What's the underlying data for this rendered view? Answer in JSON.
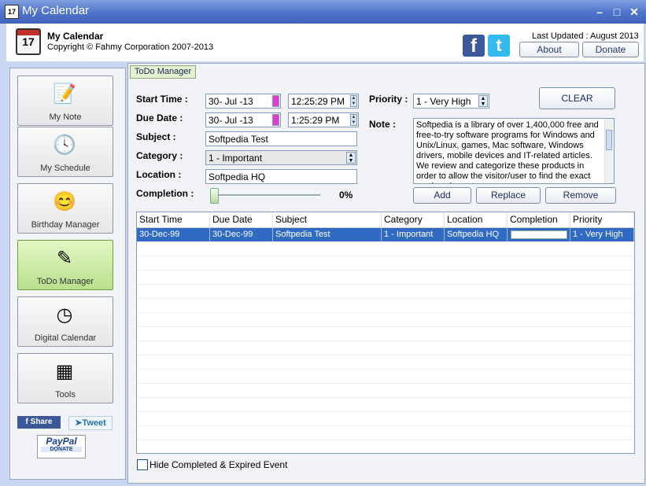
{
  "window": {
    "title": "My Calendar"
  },
  "header": {
    "app_name": "My Calendar",
    "copyright": "Copyright © Fahmy Corporation 2007-2013",
    "last_updated": "Last Updated : August 2013",
    "about_label": "About",
    "donate_label": "Donate",
    "logo_day": "17"
  },
  "sidebar": {
    "items": [
      {
        "label": "My Note",
        "icon": "notepad-icon"
      },
      {
        "label": "My Schedule",
        "icon": "clock-icon"
      },
      {
        "label": "Birthday Manager",
        "icon": "smiley-icon"
      },
      {
        "label": "ToDo Manager",
        "icon": "todo-icon"
      },
      {
        "label": "Digital Calendar",
        "icon": "calendar-clock-icon"
      },
      {
        "label": "Tools",
        "icon": "cubes-icon"
      }
    ],
    "share_label": "f  Share",
    "tweet_label": "Tweet",
    "paypal_label": "PayPal",
    "paypal_donate": "DONATE"
  },
  "todo": {
    "tab_label": "ToDo Manager",
    "start_time_label": "Start Time :",
    "start_date": "30- Jul -13",
    "start_clock": "12:25:29 PM",
    "due_date_label": "Due Date :",
    "due_date": "30- Jul -13",
    "due_clock": "1:25:29 PM",
    "subject_label": "Subject :",
    "subject_value": "Softpedia Test",
    "category_label": "Category :",
    "category_value": "1 - Important",
    "location_label": "Location :",
    "location_value": "Softpedia HQ",
    "completion_label": "Completion :",
    "completion_value": 0,
    "completion_text": "0%",
    "priority_label": "Priority :",
    "priority_value": "1 - Very High",
    "note_label": "Note :",
    "note_text": "Softpedia is a library of over 1,400,000 free and free-to-try software programs for Windows and Unix/Linux, games, Mac software, Windows drivers, mobile devices and IT-related articles. We review and categorize these products in order to allow the visitor/user to find the exact product they",
    "clear_label": "CLEAR",
    "add_label": "Add",
    "replace_label": "Replace",
    "remove_label": "Remove"
  },
  "grid": {
    "columns": [
      "Start Time",
      "Due Date",
      "Subject",
      "Category",
      "Location",
      "Completion",
      "Priority"
    ],
    "rows": [
      [
        "30-Dec-99",
        "30-Dec-99",
        "Softpedia Test",
        "1 - Important",
        "Softpedia HQ",
        "",
        "1 - Very High"
      ]
    ]
  },
  "footer": {
    "hide_label": "Hide Completed & Expired Event"
  },
  "colors": {
    "selection": "#316ac5",
    "titlebar": "#4e73c8",
    "active_nav": "#b8e08c"
  }
}
